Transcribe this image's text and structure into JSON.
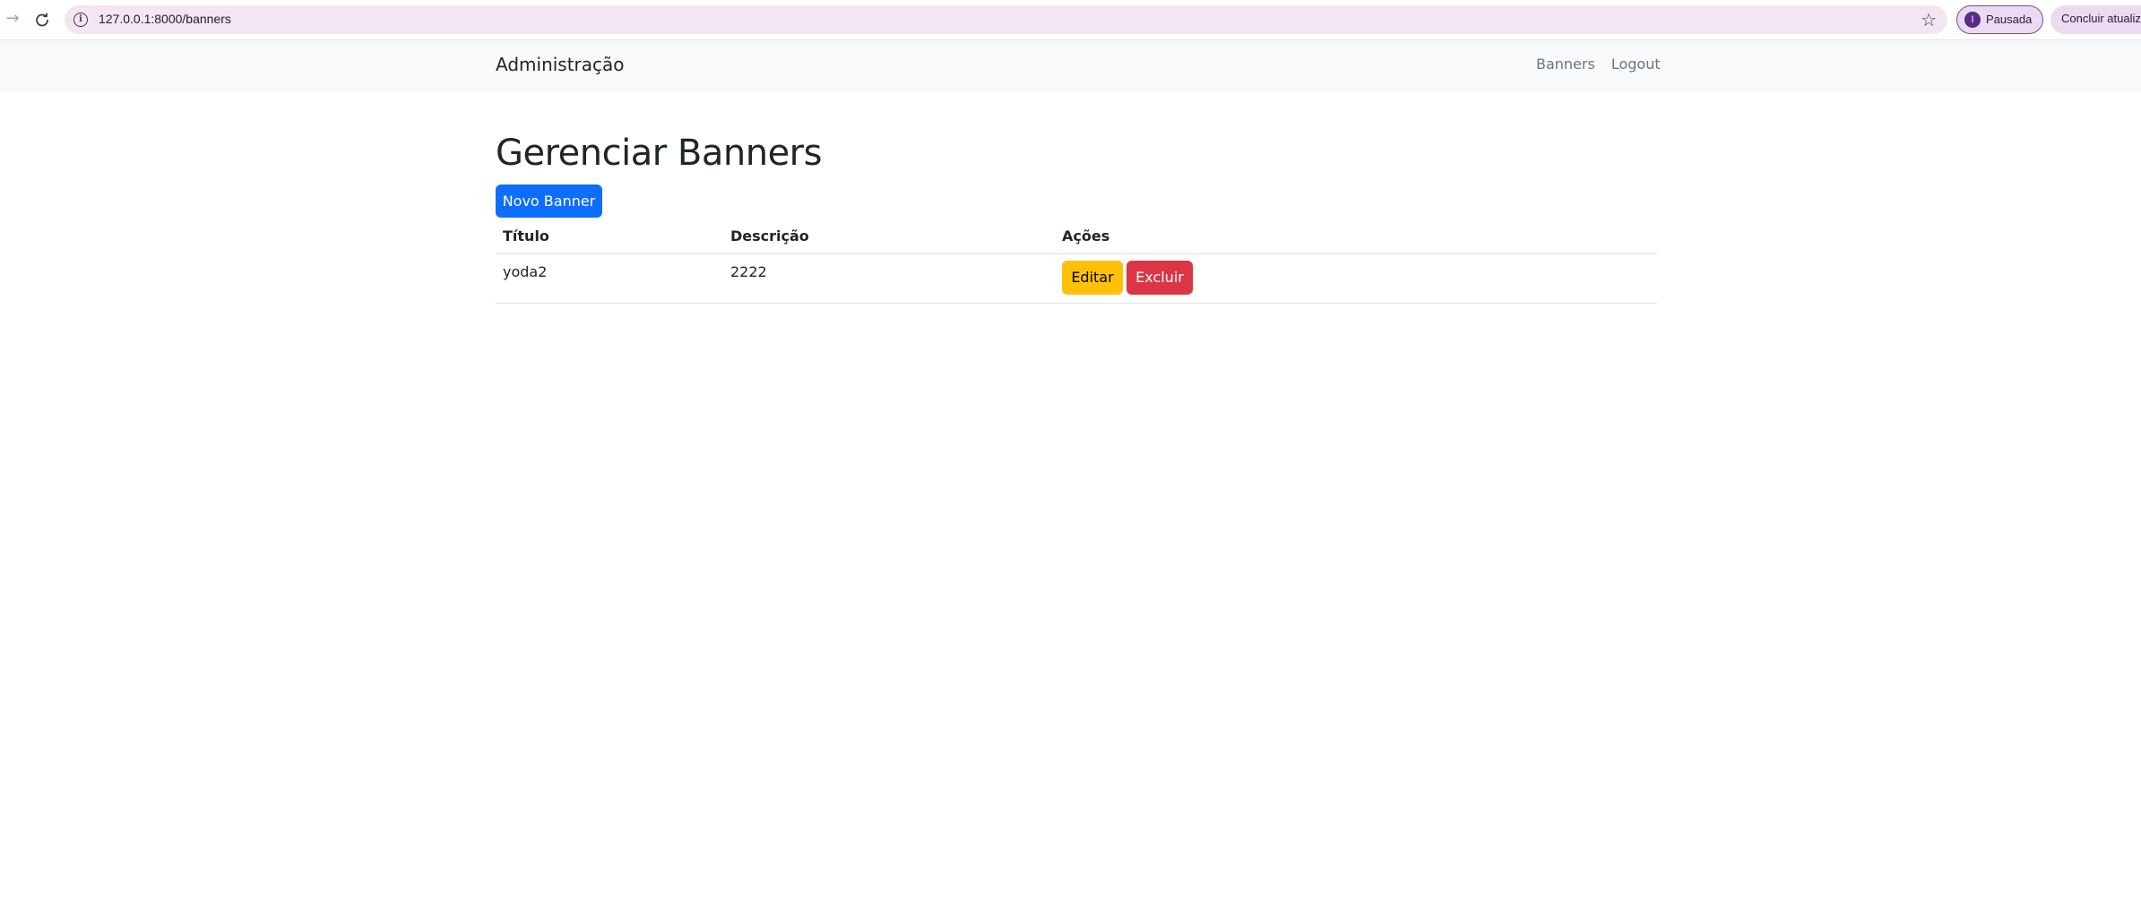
{
  "browser": {
    "url": "127.0.0.1:8000/banners",
    "profile_initial": "I",
    "profile_label": "Pausada",
    "update_label": "Concluir atualização"
  },
  "navbar": {
    "brand": "Administração",
    "links": [
      "Banners",
      "Logout"
    ]
  },
  "page": {
    "title": "Gerenciar Banners",
    "new_button": "Novo Banner"
  },
  "table": {
    "headers": [
      "Título",
      "Descrição",
      "Ações"
    ],
    "rows": [
      {
        "titulo": "yoda2",
        "descricao": "2222",
        "edit_label": "Editar",
        "delete_label": "Excluir"
      }
    ]
  },
  "colors": {
    "primary": "#0d6efd",
    "warning": "#ffc107",
    "danger": "#dc3545",
    "navbar_bg": "#f8f9fa",
    "omnibox_bg": "#f1e6f1"
  }
}
